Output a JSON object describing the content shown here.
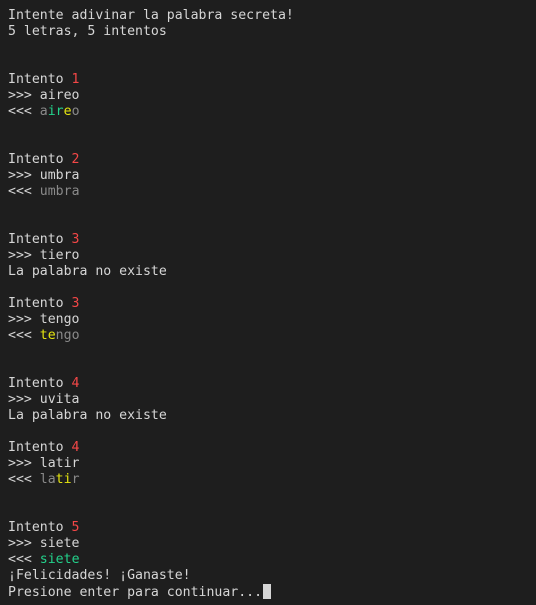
{
  "intro": {
    "line1": "Intente adivinar la palabra secreta!",
    "line2": "5 letras, 5 intentos"
  },
  "prompt_in": ">>> ",
  "prompt_out": "<<< ",
  "attempt_label": "Intento ",
  "colors": {
    "background": "#1e1e1e",
    "text": "#d6d6d6",
    "attempt_number": "#f44747",
    "correct_position": "#23d18b",
    "present_letter": "#e5e510",
    "absent_letter": "#8a8a8a"
  },
  "attempts": [
    {
      "number": "1",
      "guess": "aireo",
      "feedback": [
        {
          "ch": "a",
          "state": "gray"
        },
        {
          "ch": "i",
          "state": "green"
        },
        {
          "ch": "r",
          "state": "green"
        },
        {
          "ch": "e",
          "state": "yellow"
        },
        {
          "ch": "o",
          "state": "gray"
        }
      ]
    },
    {
      "number": "2",
      "guess": "umbra",
      "feedback": [
        {
          "ch": "u",
          "state": "gray"
        },
        {
          "ch": "m",
          "state": "gray"
        },
        {
          "ch": "b",
          "state": "gray"
        },
        {
          "ch": "r",
          "state": "gray"
        },
        {
          "ch": "a",
          "state": "gray"
        }
      ]
    },
    {
      "number": "3",
      "guess": "tiero",
      "message": "La palabra no existe"
    },
    {
      "number": "3",
      "guess": "tengo",
      "feedback": [
        {
          "ch": "t",
          "state": "yellow"
        },
        {
          "ch": "e",
          "state": "yellow"
        },
        {
          "ch": "n",
          "state": "gray"
        },
        {
          "ch": "g",
          "state": "gray"
        },
        {
          "ch": "o",
          "state": "gray"
        }
      ]
    },
    {
      "number": "4",
      "guess": "uvita",
      "message": "La palabra no existe"
    },
    {
      "number": "4",
      "guess": "latir",
      "feedback": [
        {
          "ch": "l",
          "state": "gray"
        },
        {
          "ch": "a",
          "state": "gray"
        },
        {
          "ch": "t",
          "state": "yellow"
        },
        {
          "ch": "i",
          "state": "yellow"
        },
        {
          "ch": "r",
          "state": "gray"
        }
      ]
    },
    {
      "number": "5",
      "guess": "siete",
      "feedback": [
        {
          "ch": "s",
          "state": "green"
        },
        {
          "ch": "i",
          "state": "green"
        },
        {
          "ch": "e",
          "state": "green"
        },
        {
          "ch": "t",
          "state": "green"
        },
        {
          "ch": "e",
          "state": "green"
        }
      ]
    }
  ],
  "outro": {
    "win": "¡Felicidades! ¡Ganaste!",
    "continue": "Presione enter para continuar..."
  }
}
